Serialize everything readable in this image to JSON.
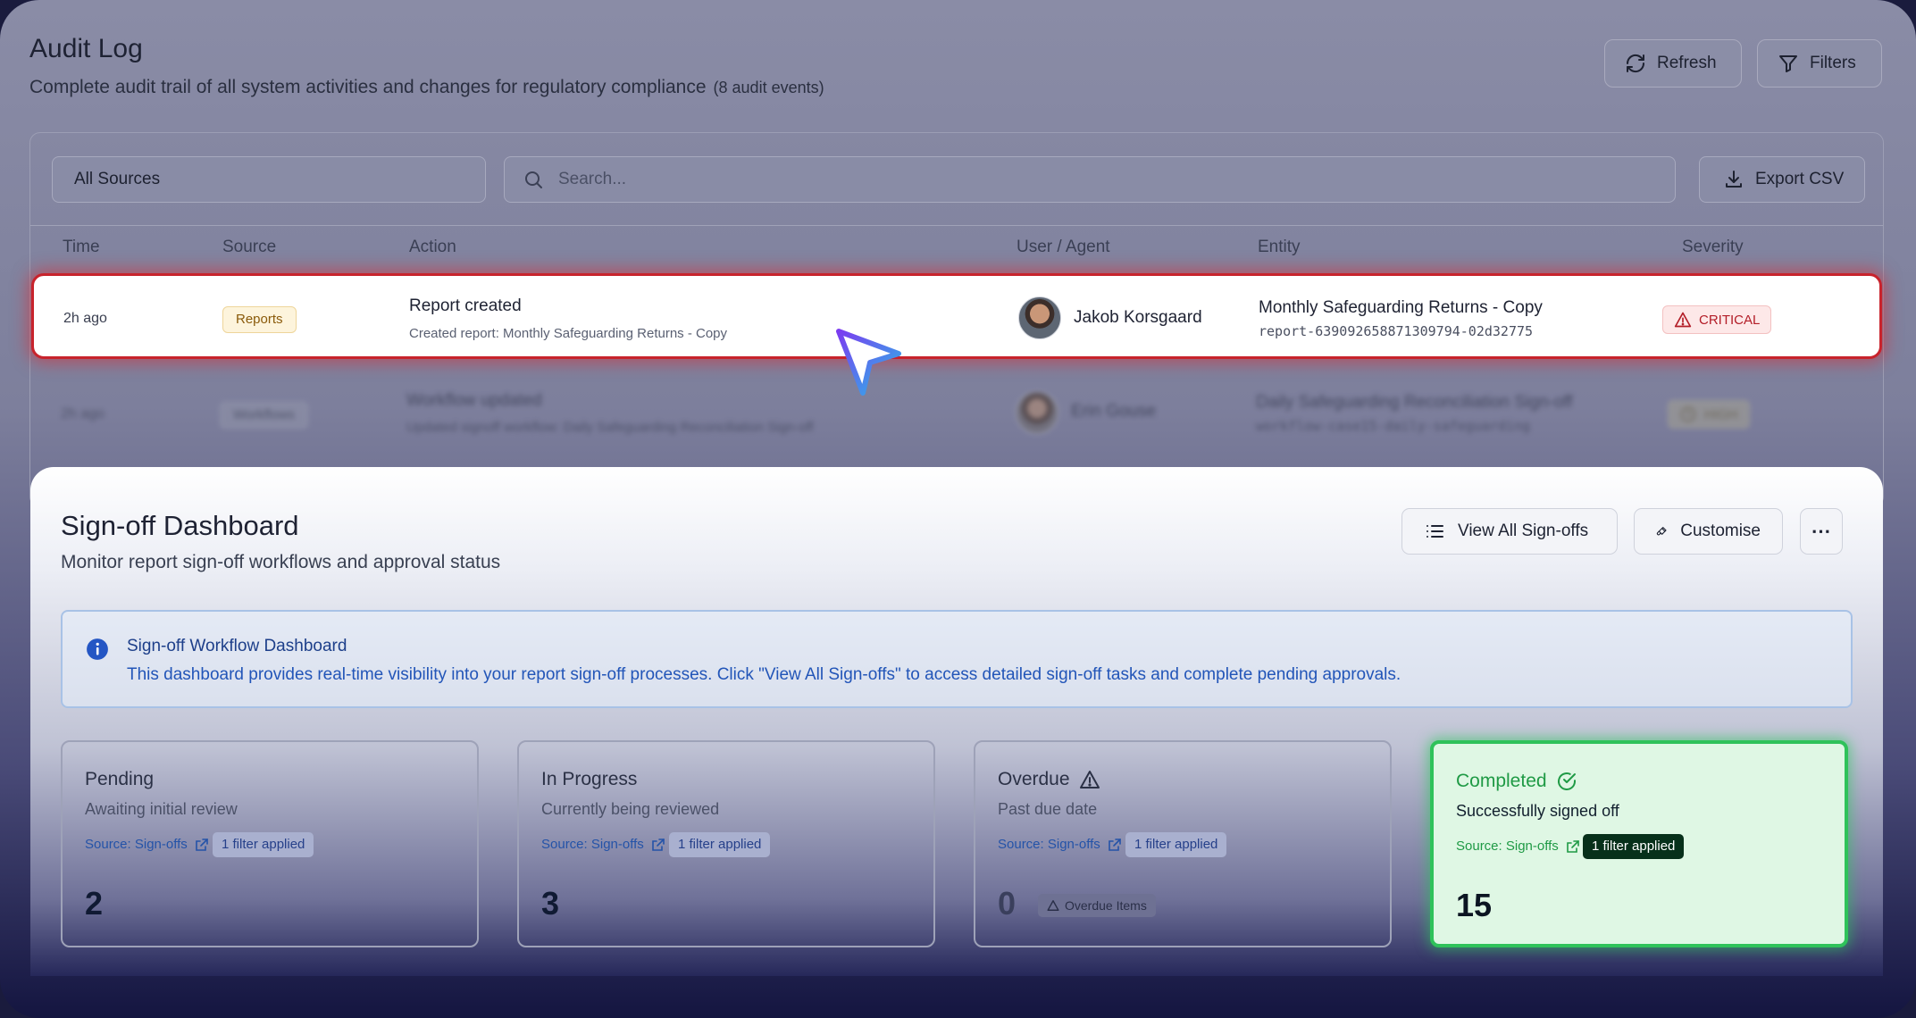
{
  "audit": {
    "title": "Audit Log",
    "subtitle": "Complete audit trail of all system activities and changes for regulatory compliance",
    "event_count": "(8 audit events)",
    "refresh_label": "Refresh",
    "filters_label": "Filters",
    "sources_value": "All Sources",
    "search_placeholder": "Search...",
    "export_label": "Export CSV",
    "columns": [
      "Time",
      "Source",
      "Action",
      "User / Agent",
      "Entity",
      "Severity"
    ],
    "rows": [
      {
        "time": "2h ago",
        "source": "Reports",
        "action_title": "Report created",
        "action_desc": "Created report: Monthly Safeguarding Returns - Copy",
        "user": "Jakob Korsgaard",
        "entity_name": "Monthly Safeguarding Returns - Copy",
        "entity_id": "report-639092658871309794-02d32775",
        "severity": "CRITICAL"
      },
      {
        "time": "2h ago",
        "source": "Workflows",
        "action_title": "Workflow updated",
        "action_desc": "Updated signoff workflow: Daily Safeguarding Reconciliation Sign-off",
        "user": "Erin Gouse",
        "entity_name": "Daily Safeguarding Reconciliation Sign-off",
        "entity_id": "workflow-case15-daily-safeguarding",
        "severity": "HIGH"
      }
    ]
  },
  "dashboard": {
    "title": "Sign-off Dashboard",
    "subtitle": "Monitor report sign-off workflows and approval status",
    "view_all_label": "View All Sign-offs",
    "customise_label": "Customise",
    "more_label": "⋯",
    "info_title": "Sign-off Workflow Dashboard",
    "info_text": "This dashboard provides real-time visibility into your report sign-off processes. Click \"View All Sign-offs\" to access detailed sign-off tasks and complete pending approvals.",
    "cards": [
      {
        "title": "Pending",
        "subtitle": "Awaiting initial review",
        "source": "Source: Sign-offs",
        "filter": "1 filter applied",
        "value": "2"
      },
      {
        "title": "In Progress",
        "subtitle": "Currently being reviewed",
        "source": "Source: Sign-offs",
        "filter": "1 filter applied",
        "value": "3"
      },
      {
        "title": "Overdue",
        "subtitle": "Past due date",
        "source": "Source: Sign-offs",
        "filter": "1 filter applied",
        "value": "0",
        "extra": "Overdue Items"
      },
      {
        "title": "Completed",
        "subtitle": "Successfully signed off",
        "source": "Source: Sign-offs",
        "filter": "1 filter applied",
        "value": "15"
      }
    ]
  },
  "colors": {
    "critical": "#c8232c",
    "completed": "#2fc25a",
    "link_blue": "#2255b8"
  }
}
